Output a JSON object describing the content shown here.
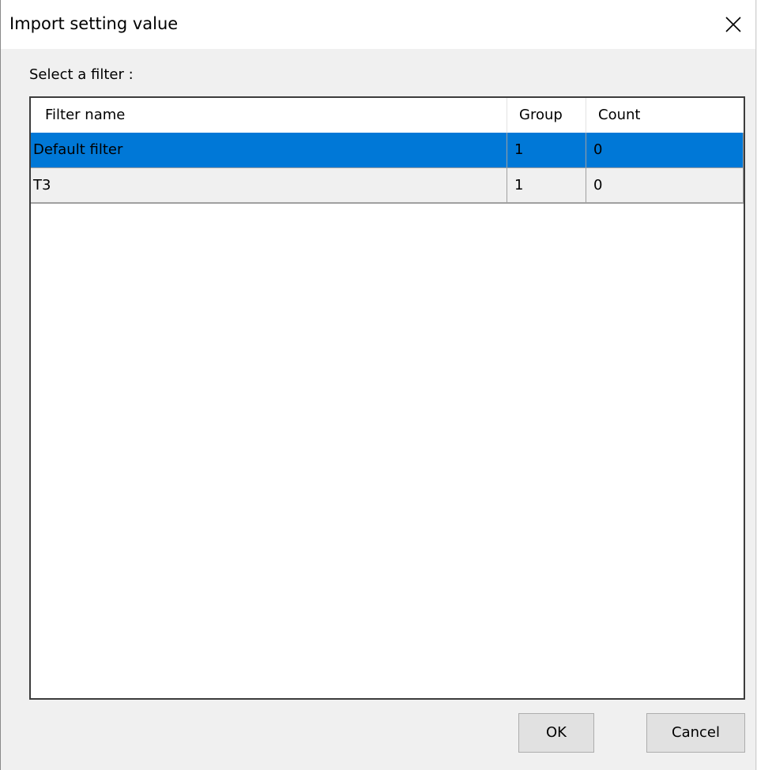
{
  "window": {
    "title": "Import setting value",
    "close_icon": "close-icon"
  },
  "prompt": "Select a filter :",
  "table": {
    "columns": [
      "Filter name",
      "Group",
      "Count"
    ],
    "rows": [
      {
        "filter_name": "Default filter",
        "group": "1",
        "count": "0",
        "selected": true
      },
      {
        "filter_name": "T3",
        "group": "1",
        "count": "0",
        "selected": false
      }
    ]
  },
  "buttons": {
    "ok_label": "OK",
    "cancel_label": "Cancel"
  },
  "colors": {
    "selection": "#0078d7",
    "dialog_bg": "#f0f0f0",
    "titlebar_bg": "#ffffff"
  }
}
